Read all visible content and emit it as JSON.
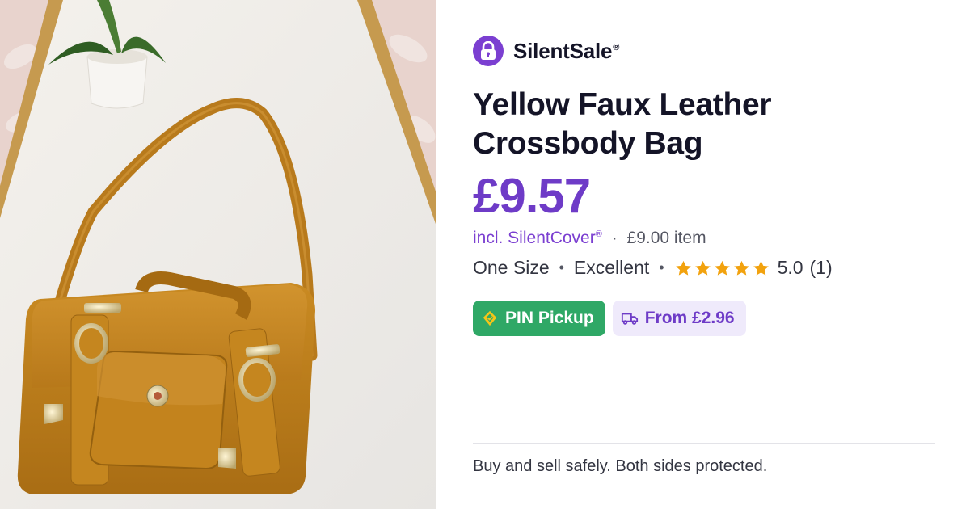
{
  "brand": {
    "name": "SilentSale",
    "mark": "®",
    "icon": "padlock-icon",
    "color": "#7b3fd1"
  },
  "product": {
    "image": {
      "description_icon": "product-photo-yellow-crossbody-bag"
    },
    "title": "Yellow Faux Leather Crossbody Bag",
    "price": "£9.57",
    "price_color": "#6e3bc7",
    "protection": {
      "label": "incl. SilentCover",
      "mark": "®",
      "separator": "·",
      "item_price": "£9.00 item"
    },
    "size": "One Size",
    "condition": "Excellent",
    "rating": {
      "stars": 5,
      "value": "5.0",
      "count": "(1)",
      "star_color": "#f2a20e"
    }
  },
  "chips": {
    "pin_pickup": {
      "label": "PIN Pickup",
      "icon": "pin-pickup-icon",
      "bg": "#2fa866"
    },
    "shipping": {
      "label": "From £2.96",
      "icon": "delivery-truck-icon",
      "bg": "#efeafb"
    }
  },
  "footer": {
    "tagline": "Buy and sell safely. Both sides protected."
  }
}
